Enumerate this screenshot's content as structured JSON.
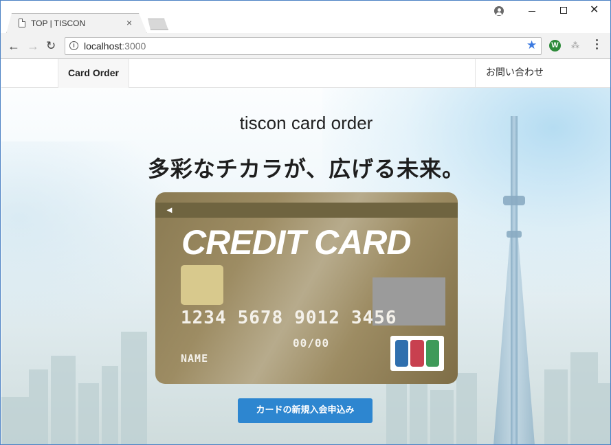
{
  "browser": {
    "tab_title": "TOP | TISCON",
    "tab_close": "×",
    "url_host": "localhost",
    "url_port": ":3000",
    "icons": {
      "back": "arrow-left-icon",
      "forward": "arrow-right-icon",
      "reload": "reload-icon",
      "info": "info-icon",
      "bookmark": "star-icon",
      "profile": "profile-icon",
      "menu": "more-vert-icon"
    },
    "glyphs": {
      "back": "←",
      "forward": "→",
      "reload": "↻",
      "info": "i",
      "star": "★",
      "extension_w": "W",
      "extension_2": "⁂",
      "window_close": "✕"
    }
  },
  "site": {
    "nav": {
      "brand": "Card Order",
      "contact": "お問い合わせ"
    },
    "hero": {
      "title": "tiscon card order",
      "copy": "多彩なチカラが、広げる未来。"
    },
    "card": {
      "arrow": "◄",
      "brand": "CREDIT CARD",
      "number_groups": [
        "1234",
        "5678",
        "9012",
        "3456"
      ],
      "expiry": "00/00",
      "name": "NAME",
      "logo_colors": [
        "#2f6fae",
        "#c8404f",
        "#3f9a59"
      ]
    },
    "cta_label": "カードの新規入会申込み"
  },
  "colors": {
    "accent": "#2d86d0",
    "card_gold": "#9d8c63"
  }
}
